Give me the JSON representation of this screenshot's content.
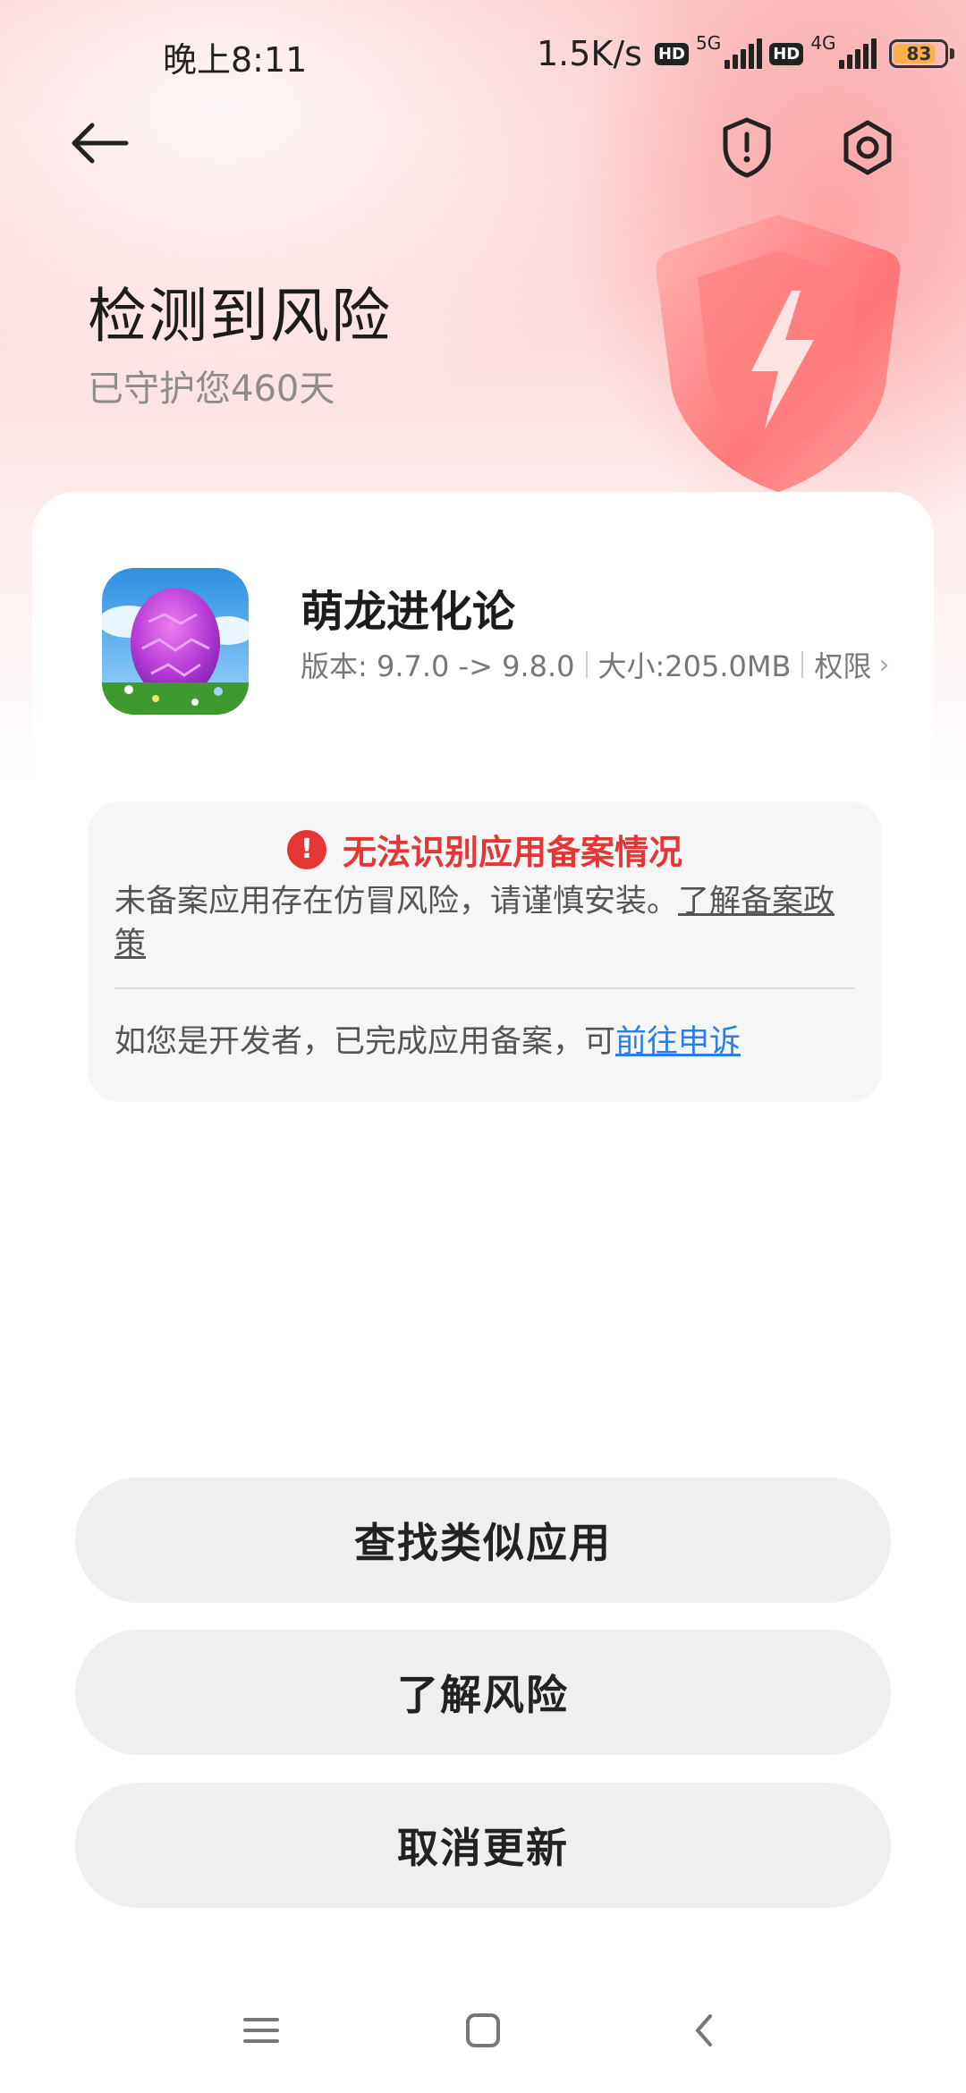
{
  "status_bar": {
    "time": "晚上8:11",
    "net_speed": "1.5K/s",
    "hd1": "HD",
    "sig1_label": "5G",
    "hd2": "HD",
    "sig2_label": "4G",
    "battery": "83",
    "battery_color": "#ffb04a"
  },
  "header": {
    "back_icon": "arrow-left-icon",
    "shield_icon": "shield-alert-icon",
    "settings_icon": "gear-icon"
  },
  "hero": {
    "title": "检测到风险",
    "subtitle": "已守护您460天",
    "accent": "#ff6b6b"
  },
  "app": {
    "name": "萌龙进化论",
    "version": "版本: 9.7.0 -> 9.8.0",
    "size": "大小:205.0MB",
    "permissions": "权限",
    "chevron": "›"
  },
  "warning": {
    "icon_glyph": "!",
    "title": "无法识别应用备案情况",
    "desc": "未备案应用存在仿冒风险，请谨慎安装。",
    "policy_link": "了解备案政策",
    "footer": "如您是开发者，已完成应用备案，可",
    "appeal_link": "前往申诉",
    "color": "#e53535",
    "link_color": "#2b7de9"
  },
  "actions": {
    "find_similar": "查找类似应用",
    "learn_risk": "了解风险",
    "cancel_update": "取消更新"
  },
  "nav": {
    "menu_icon": "menu-icon",
    "home_icon": "home-square-icon",
    "back_icon": "chevron-left-icon"
  }
}
